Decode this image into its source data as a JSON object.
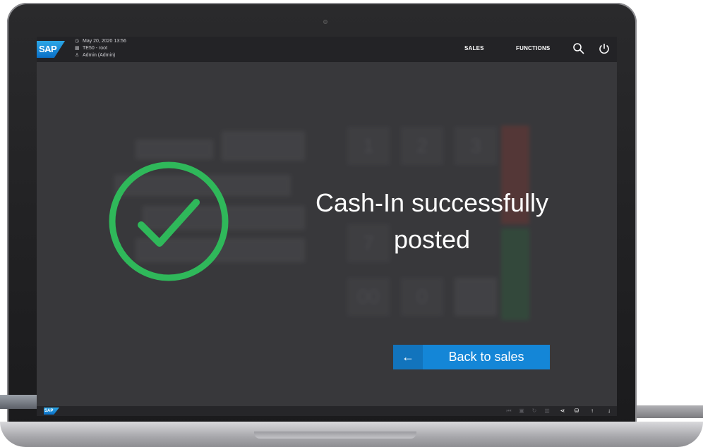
{
  "header": {
    "logo": "SAP",
    "datetime": "May 20, 2020 13:56",
    "store": "TE50 - root",
    "user": "Admin (Admin)",
    "nav": [
      "SALES",
      "FUNCTIONS"
    ],
    "icons": [
      "clock-icon",
      "store-icon",
      "user-icon",
      "search-icon",
      "power-icon"
    ]
  },
  "dialog": {
    "message": "Cash-In successfully posted",
    "status_color": "#2fb85a",
    "back_label": "Back to sales",
    "back_arrow": "←",
    "button_color": "#1486d7"
  },
  "background_keypad": [
    "1",
    "2",
    "3",
    "7",
    "00",
    "0"
  ],
  "footer": {
    "logo": "SAP",
    "icons": [
      "first-page-icon",
      "lock-icon",
      "redo-icon",
      "grid-icon",
      "share-icon",
      "database-icon",
      "arrow-up-icon",
      "arrow-down-icon"
    ]
  }
}
